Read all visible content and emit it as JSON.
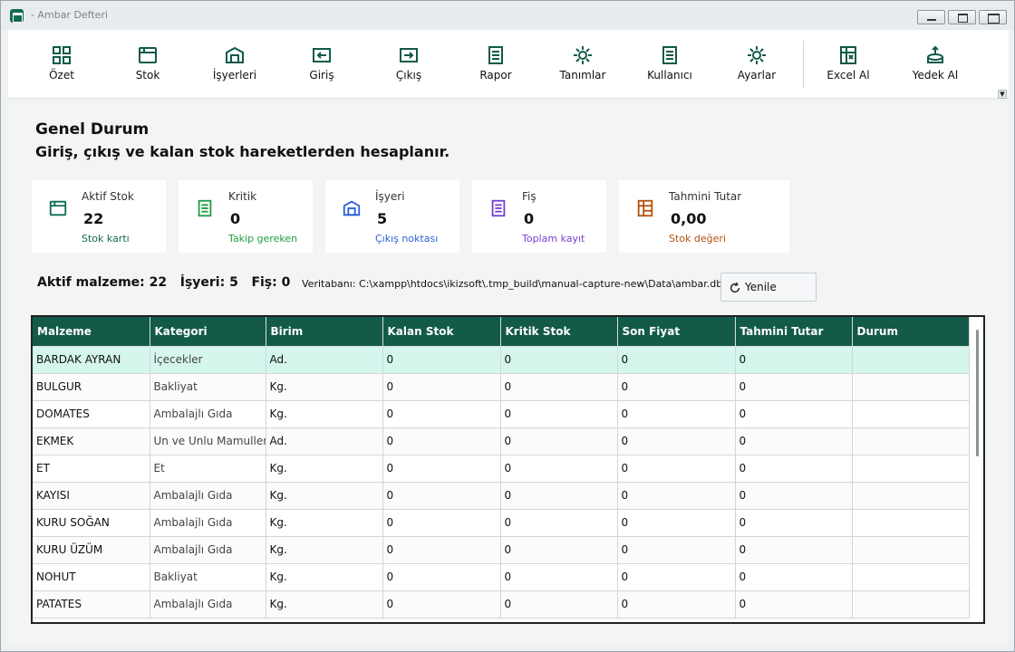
{
  "window": {
    "title": "- Ambar Defteri"
  },
  "toolbar": {
    "items": [
      {
        "label": "Özet",
        "icon": "grid-icon"
      },
      {
        "label": "Stok",
        "icon": "box-icon"
      },
      {
        "label": "İşyerleri",
        "icon": "warehouse-icon"
      },
      {
        "label": "Giriş",
        "icon": "sign-in-icon"
      },
      {
        "label": "Çıkış",
        "icon": "sign-out-icon"
      },
      {
        "label": "Rapor",
        "icon": "report-icon"
      },
      {
        "label": "Tanımlar",
        "icon": "settings-icon"
      },
      {
        "label": "Kullanıcı",
        "icon": "user-doc-icon"
      },
      {
        "label": "Ayarlar",
        "icon": "gear-icon"
      },
      {
        "label": "Excel Al",
        "icon": "excel-icon"
      },
      {
        "label": "Yedek Al",
        "icon": "backup-icon"
      }
    ]
  },
  "page": {
    "title": "Genel Durum",
    "subtitle": "Giriş, çıkış ve kalan stok hareketlerden hesaplanır."
  },
  "cards": [
    {
      "label": "Aktif Stok",
      "value": "22",
      "sub": "Stok kartı",
      "color": "#0f6b55"
    },
    {
      "label": "Kritik",
      "value": "0",
      "sub": "Takip gereken",
      "color": "#1f9d45"
    },
    {
      "label": "İşyeri",
      "value": "5",
      "sub": "Çıkış noktası",
      "color": "#2b5fd9"
    },
    {
      "label": "Fiş",
      "value": "0",
      "sub": "Toplam kayıt",
      "color": "#7a3fd1"
    },
    {
      "label": "Tahmini Tutar",
      "value": "0,00",
      "sub": "Stok değeri",
      "color": "#b4520e"
    }
  ],
  "summary": {
    "text": "Aktif malzeme: 22   İşyeri: 5   Fiş: 0"
  },
  "database": {
    "path": "Veritabanı: C:\\xampp\\htdocs\\ikizsoft\\.tmp_build\\manual-capture-new\\Data\\ambar.db"
  },
  "refresh": {
    "label": "Yenile"
  },
  "table": {
    "columns": [
      "Malzeme",
      "Kategori",
      "Birim",
      "Kalan Stok",
      "Kritik Stok",
      "Son Fiyat",
      "Tahmini Tutar",
      "Durum"
    ],
    "rows": [
      [
        "BARDAK AYRAN",
        "İçecekler",
        "Ad.",
        "0",
        "0",
        "0",
        "0",
        ""
      ],
      [
        "BULGUR",
        "Bakliyat",
        "Kg.",
        "0",
        "0",
        "0",
        "0",
        ""
      ],
      [
        "DOMATES",
        "Ambalajlı Gıda",
        "Kg.",
        "0",
        "0",
        "0",
        "0",
        ""
      ],
      [
        "EKMEK",
        "Un ve Unlu Mamulleri",
        "Ad.",
        "0",
        "0",
        "0",
        "0",
        ""
      ],
      [
        "ET",
        "Et",
        "Kg.",
        "0",
        "0",
        "0",
        "0",
        ""
      ],
      [
        "KAYISI",
        "Ambalajlı Gıda",
        "Kg.",
        "0",
        "0",
        "0",
        "0",
        ""
      ],
      [
        "KURU SOĞAN",
        "Ambalajlı Gıda",
        "Kg.",
        "0",
        "0",
        "0",
        "0",
        ""
      ],
      [
        "KURU ÜZÜM",
        "Ambalajlı Gıda",
        "Kg.",
        "0",
        "0",
        "0",
        "0",
        ""
      ],
      [
        "NOHUT",
        "Bakliyat",
        "Kg.",
        "0",
        "0",
        "0",
        "0",
        ""
      ],
      [
        "PATATES",
        "Ambalajlı Gıda",
        "Kg.",
        "0",
        "0",
        "0",
        "0",
        ""
      ]
    ]
  },
  "colors": {
    "header": "#135a49",
    "selected_row": "#d4f6ed",
    "accent": "#0f6b55"
  }
}
